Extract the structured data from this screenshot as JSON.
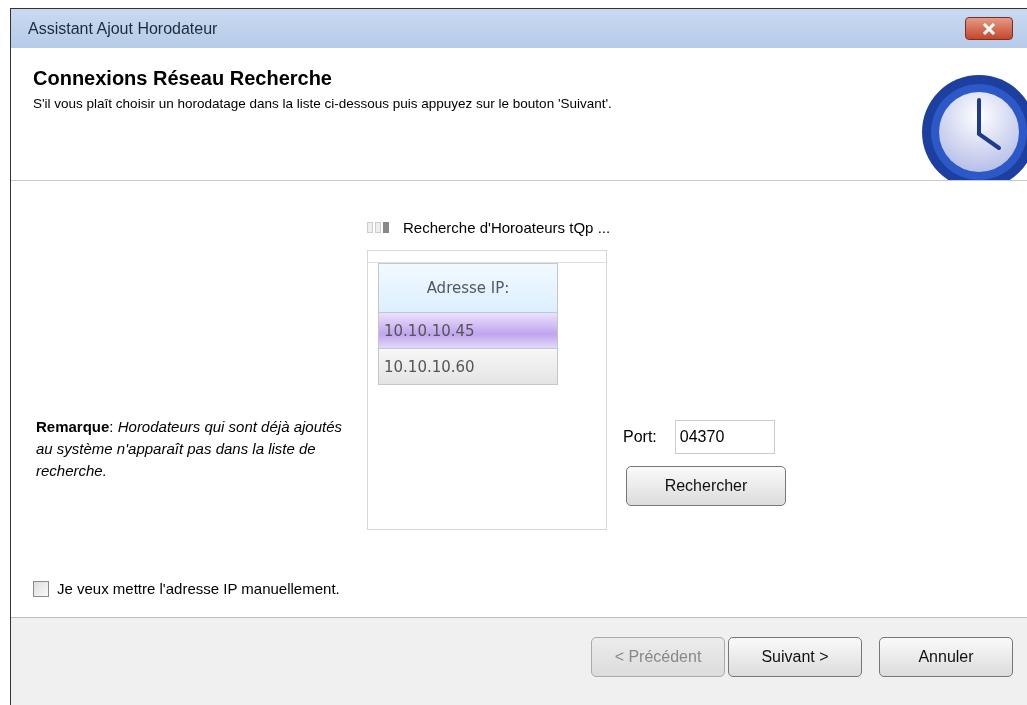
{
  "window": {
    "title": "Assistant Ajout Horodateur"
  },
  "header": {
    "title": "Connexions Réseau Recherche",
    "subtitle": "S'il vous plaît choisir un horodatage dans la liste ci-dessous puis appuyez sur le bouton 'Suivant'."
  },
  "search_status": "Recherche d'Horoateurs tQp ...",
  "ip_table": {
    "column": "Adresse IP:",
    "rows": [
      {
        "address": "10.10.10.45",
        "selected": true
      },
      {
        "address": "10.10.10.60",
        "selected": false
      }
    ]
  },
  "note": "**Remarque**: *Horodateurs qui sont déjà ajoutés au système n'apparaît pas dans la liste de recherche.*",
  "port": {
    "label": "Port:",
    "value": "04370"
  },
  "search_button": "Rechercher",
  "manual_checkbox": {
    "label": "Je veux mettre l'adresse IP manuellement.",
    "checked": false
  },
  "buttons": [
    {
      "label": "< Précédent",
      "disabled": true
    },
    {
      "label": "Suivant >",
      "disabled": false
    },
    {
      "label": "Annuler",
      "disabled": false
    }
  ]
}
